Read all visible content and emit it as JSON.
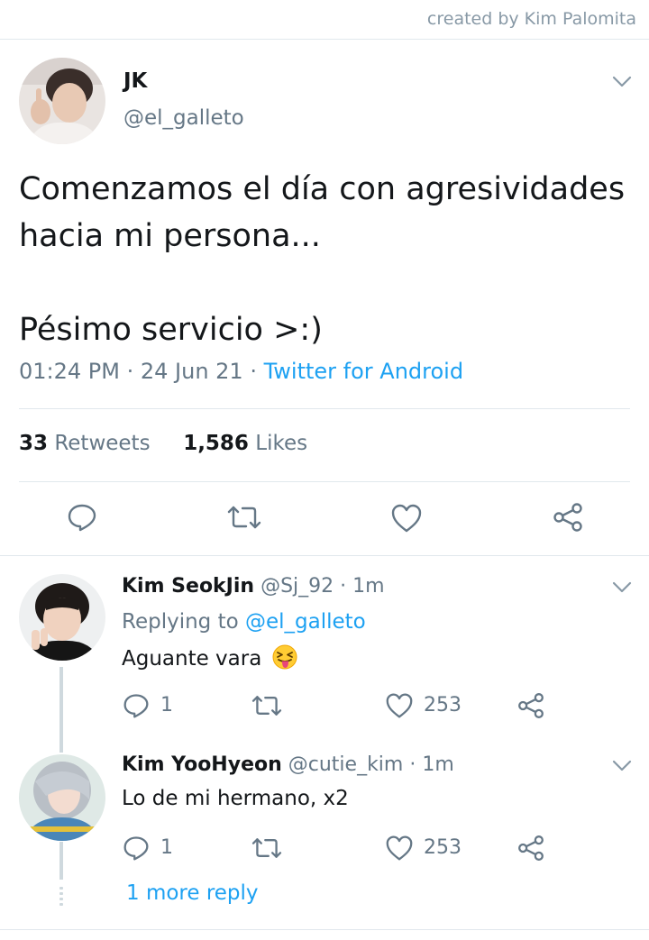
{
  "credit": "created by Kim Palomita",
  "tweet": {
    "name": "JK",
    "handle": "@el_galleto",
    "text": "Comenzamos el día con agresividades\nhacia mi persona...\n\nPésimo servicio >:)",
    "time": "01:24 PM · 24 Jun 21 · ",
    "source": "Twitter for Android",
    "retweets_count": "33",
    "retweets_label": "Retweets",
    "likes_count": "1,586",
    "likes_label": "Likes"
  },
  "replies": [
    {
      "name": "Kim SeokJin",
      "handle_time": " @Sj_92 · 1m",
      "replying_prefix": "Replying to ",
      "replying_handle": "@el_galleto",
      "text": "Aguante vara",
      "reply_count": "1",
      "like_count": "253"
    },
    {
      "name": "Kim YooHyeon",
      "handle_time": " @cutie_kim · 1m",
      "text": "Lo de mi hermano, x2",
      "reply_count": "1",
      "like_count": "253"
    }
  ],
  "more_replies": "1 more reply",
  "colors": {
    "accent": "#1da1f2",
    "secondary_text": "#657786",
    "divider": "#e1e8ed"
  },
  "icons": [
    "chevron-down-icon",
    "reply-icon",
    "retweet-icon",
    "like-icon",
    "share-icon",
    "squinting-tongue-emoji-icon"
  ]
}
